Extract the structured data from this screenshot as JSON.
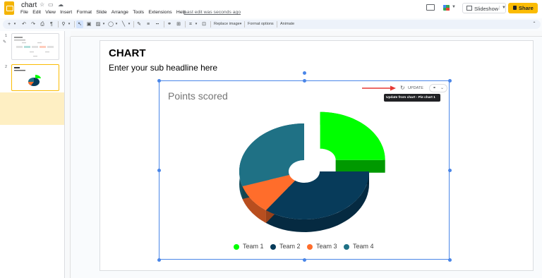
{
  "app": {
    "doc_title": "chart",
    "menu": [
      "File",
      "Edit",
      "View",
      "Insert",
      "Format",
      "Slide",
      "Arrange",
      "Tools",
      "Extensions",
      "Help"
    ],
    "last_edit": "Last edit was seconds ago",
    "slideshow_label": "Slideshow",
    "share_label": "Share"
  },
  "toolbar": {
    "replace_image": "Replace image",
    "format_options": "Format options",
    "animate": "Animate"
  },
  "filmstrip": {
    "slides": [
      {
        "number": "1"
      },
      {
        "number": "2"
      }
    ]
  },
  "slide": {
    "title": "CHART",
    "subtitle": "Enter your sub headline here",
    "update_label": "UPDATE",
    "tooltip": "Update from chart - Pie chart 1"
  },
  "chart_data": {
    "type": "pie",
    "title": "Points scored",
    "style": "3d-exploded-donut",
    "legend_position": "bottom",
    "series": [
      {
        "name": "Team 1",
        "value": 25,
        "color": "#00ff00"
      },
      {
        "name": "Team 2",
        "value": 35,
        "color": "#073b5a"
      },
      {
        "name": "Team 3",
        "value": 10,
        "color": "#ff6d2b"
      },
      {
        "name": "Team 4",
        "value": 30,
        "color": "#1f7185"
      }
    ]
  },
  "colors": {
    "accent_yellow": "#fbbc04",
    "selection_blue": "#4a86e8",
    "arrow_red": "#e53935"
  }
}
